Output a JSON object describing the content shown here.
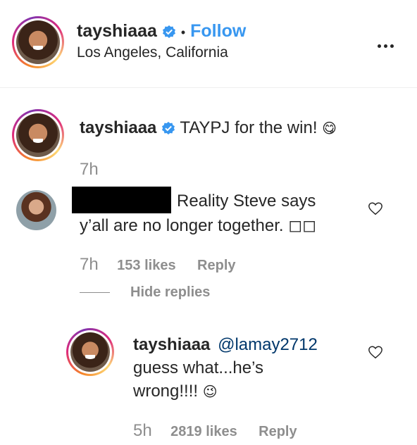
{
  "post_header": {
    "username": "tayshiaaa",
    "separator": "•",
    "follow_label": "Follow",
    "location": "Los Angeles, California"
  },
  "caption": {
    "username": "tayshiaaa",
    "text": "TAYPJ for the win!",
    "emoji": "😋",
    "time": "7h"
  },
  "comment": {
    "text_line1": "Reality Steve says",
    "text_line2": "y’all are no longer together. ◻◻",
    "time": "7h",
    "likes": "153 likes",
    "reply_label": "Reply",
    "hide_replies_label": "Hide replies"
  },
  "reply": {
    "username": "tayshiaaa",
    "mention": "@lamay2712",
    "text_line1": "guess what...he’s",
    "text_line2": "wrong!!!!",
    "emoji": "😉",
    "time": "5h",
    "likes": "2819 likes",
    "reply_label": "Reply"
  },
  "colors": {
    "link_blue": "#3897f0",
    "mention_blue": "#00376b",
    "text_primary": "#262626",
    "text_secondary": "#8e8e8e",
    "redaction": "#000000"
  }
}
